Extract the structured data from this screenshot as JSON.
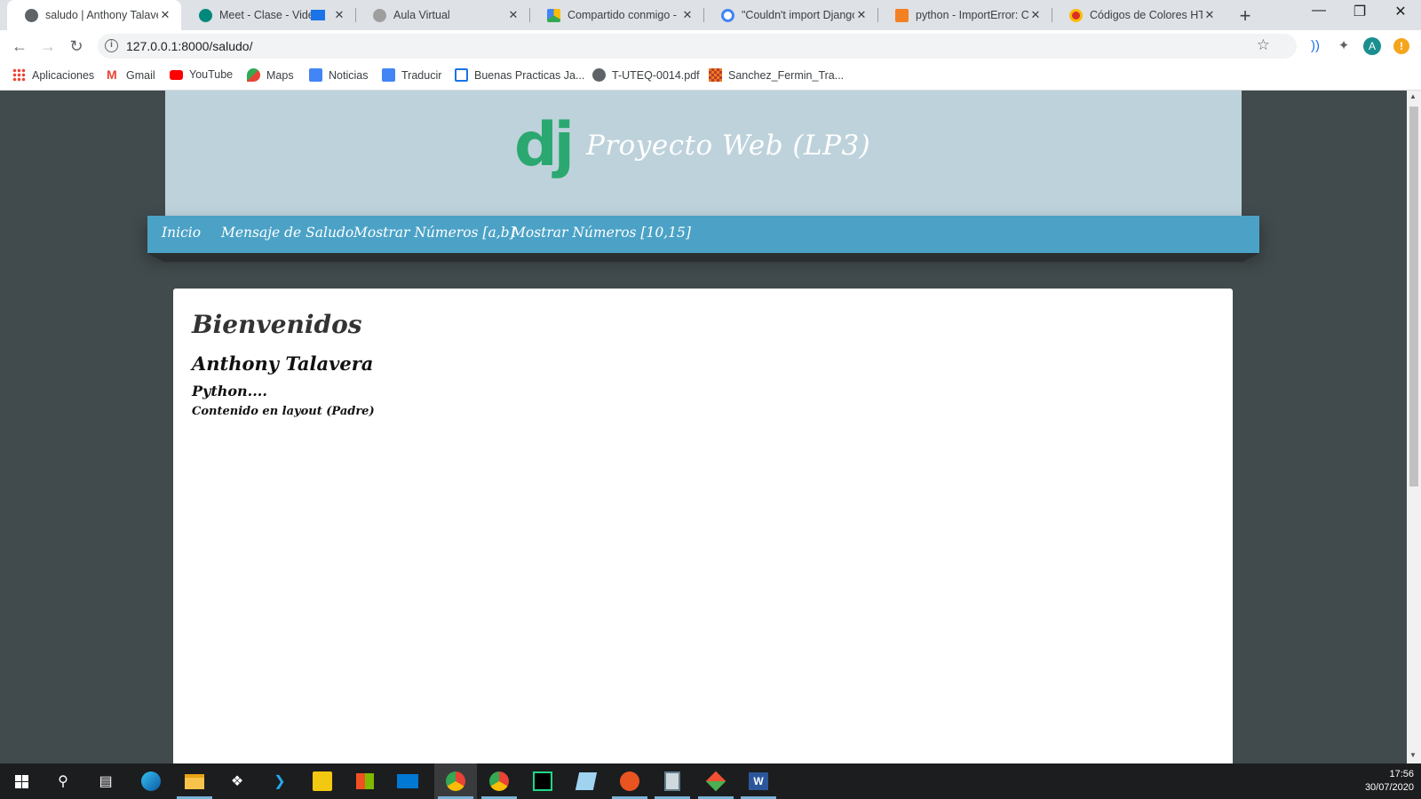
{
  "browser": {
    "tabs": [
      {
        "title": "saludo | Anthony Talavera",
        "active": true
      },
      {
        "title": "Meet - Clase - Video",
        "active": false
      },
      {
        "title": "Aula Virtual",
        "active": false
      },
      {
        "title": "Compartido conmigo - Google Drive",
        "active": false
      },
      {
        "title": "\"Couldn't import Django\"",
        "active": false
      },
      {
        "title": "python - ImportError: Co",
        "active": false
      },
      {
        "title": "Códigos de Colores HTML",
        "active": false
      }
    ],
    "url": "127.0.0.1:8000/saludo/",
    "avatar_letter": "A",
    "update_badge": "!",
    "bookmarks": [
      "Aplicaciones",
      "Gmail",
      "YouTube",
      "Maps",
      "Noticias",
      "Traducir",
      "Buenas Practicas Ja...",
      "T-UTEQ-0014.pdf",
      "Sanchez_Fermin_Tra..."
    ]
  },
  "site": {
    "logo": "dj",
    "title": "Proyecto Web (LP3)",
    "nav": [
      "Inicio",
      "Mensaje de Saludo",
      "Mostrar Números [a,b]",
      "Mostrar Números [10,15]"
    ],
    "heading": "Bienvenidos",
    "name": "Anthony Talavera",
    "subheading": "Python....",
    "note": "Contenido en layout (Padre)"
  },
  "taskbar": {
    "time": "17:56",
    "date": "30/07/2020"
  },
  "colors": {
    "header_bg": "#bed2db",
    "nav_bg": "#4ba2c6",
    "page_bg": "#414a4c",
    "django_green": "#2ba870"
  }
}
